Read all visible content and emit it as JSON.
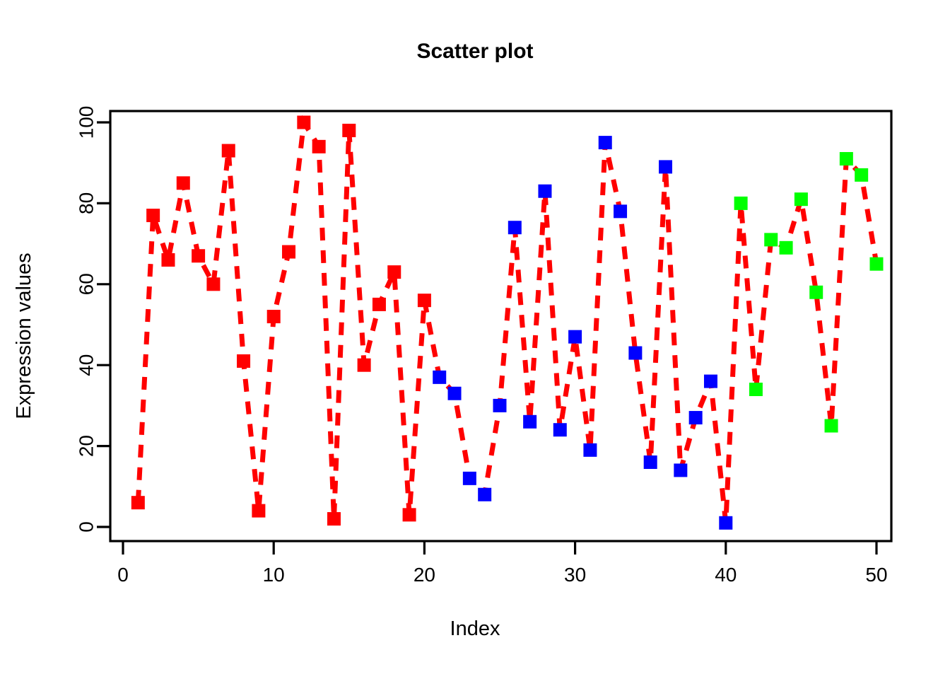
{
  "chart_data": {
    "type": "scatter",
    "title": "Scatter plot",
    "xlabel": "Index",
    "ylabel": "Expression values",
    "x": [
      1,
      2,
      3,
      4,
      5,
      6,
      7,
      8,
      9,
      10,
      11,
      12,
      13,
      14,
      15,
      16,
      17,
      18,
      19,
      20,
      21,
      22,
      23,
      24,
      25,
      26,
      27,
      28,
      29,
      30,
      31,
      32,
      33,
      34,
      35,
      36,
      37,
      38,
      39,
      40,
      41,
      42,
      43,
      44,
      45,
      46,
      47,
      48,
      49,
      50
    ],
    "values": [
      6,
      77,
      66,
      85,
      67,
      60,
      93,
      41,
      4,
      52,
      68,
      100,
      94,
      2,
      98,
      40,
      55,
      63,
      3,
      56,
      37,
      33,
      12,
      8,
      30,
      74,
      26,
      83,
      24,
      47,
      19,
      95,
      78,
      43,
      16,
      89,
      14,
      27,
      36,
      1,
      80,
      34,
      71,
      69,
      81,
      58,
      25,
      91,
      87,
      65
    ],
    "point_colors": [
      "#FF0000",
      "#FF0000",
      "#FF0000",
      "#FF0000",
      "#FF0000",
      "#FF0000",
      "#FF0000",
      "#FF0000",
      "#FF0000",
      "#FF0000",
      "#FF0000",
      "#FF0000",
      "#FF0000",
      "#FF0000",
      "#FF0000",
      "#FF0000",
      "#FF0000",
      "#FF0000",
      "#FF0000",
      "#FF0000",
      "#0000FF",
      "#0000FF",
      "#0000FF",
      "#0000FF",
      "#0000FF",
      "#0000FF",
      "#0000FF",
      "#0000FF",
      "#0000FF",
      "#0000FF",
      "#0000FF",
      "#0000FF",
      "#0000FF",
      "#0000FF",
      "#0000FF",
      "#0000FF",
      "#0000FF",
      "#0000FF",
      "#0000FF",
      "#0000FF",
      "#00FF00",
      "#00FF00",
      "#00FF00",
      "#00FF00",
      "#00FF00",
      "#00FF00",
      "#00FF00",
      "#00FF00",
      "#00FF00",
      "#00FF00"
    ],
    "line_color": "#FF0000",
    "line_style": "dashed",
    "marker": "filled-square",
    "xlim": [
      0.2,
      50.8
    ],
    "ylim": [
      -2.5,
      102.5
    ],
    "xticks": [
      0,
      10,
      20,
      30,
      40,
      50
    ],
    "yticks": [
      0,
      20,
      40,
      60,
      80,
      100
    ],
    "xtick_labels": [
      "0",
      "10",
      "20",
      "30",
      "40",
      "50"
    ],
    "ytick_labels": [
      "0",
      "20",
      "40",
      "60",
      "80",
      "100"
    ],
    "grid": false,
    "legend": null,
    "axis_color": "#000000",
    "background": "#FFFFFF",
    "color_groups": [
      {
        "name": "red-group",
        "color": "#FF0000",
        "index_range": [
          1,
          20
        ]
      },
      {
        "name": "blue-group",
        "color": "#0000FF",
        "index_range": [
          21,
          40
        ]
      },
      {
        "name": "green-group",
        "color": "#00FF00",
        "index_range": [
          41,
          50
        ]
      }
    ]
  }
}
